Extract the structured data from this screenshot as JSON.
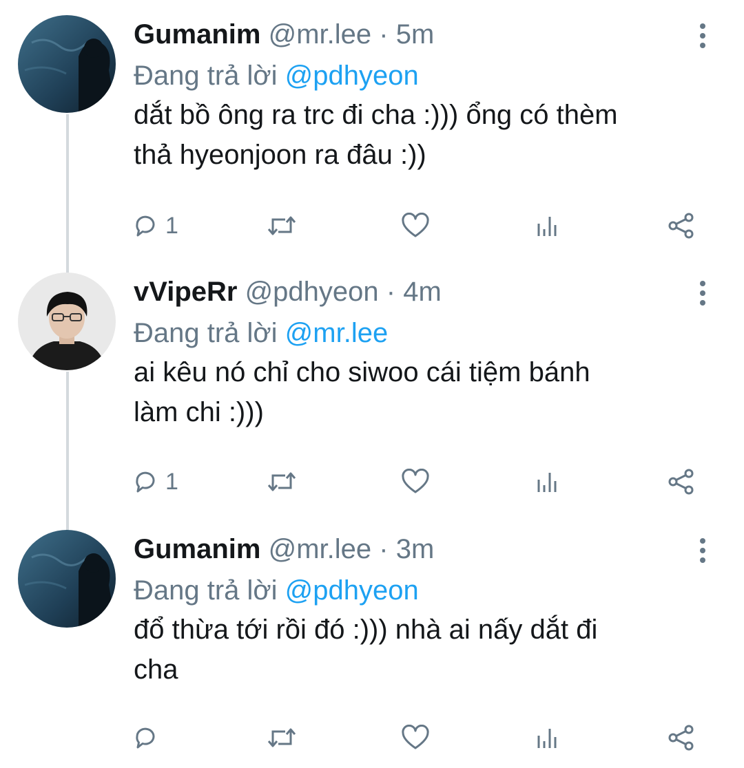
{
  "replying_prefix": "Đang trả lời",
  "tweets": [
    {
      "name": "Gumanim",
      "handle": "@mr.lee",
      "separator": "·",
      "time": "5m",
      "replying_to": "@pdhyeon",
      "text_line1": "dắt bồ ông ra trc đi cha :))) ổng có thèm",
      "text_line2": "thả hyeonjoon ra đâu :))",
      "reply_count": "1"
    },
    {
      "name": "vVipeRr",
      "handle": "@pdhyeon",
      "separator": "·",
      "time": "4m",
      "replying_to": "@mr.lee",
      "text_line1": "ai kêu nó chỉ cho siwoo cái tiệm bánh",
      "text_line2": "làm chi :)))",
      "reply_count": "1"
    },
    {
      "name": "Gumanim",
      "handle": "@mr.lee",
      "separator": "·",
      "time": "3m",
      "replying_to": "@pdhyeon",
      "text_line1": "đổ thừa tới rồi đó :))) nhà ai nấy dắt đi",
      "text_line2": "cha",
      "reply_count": ""
    }
  ],
  "colors": {
    "text": "#14171a",
    "secondary": "#657786",
    "accent": "#1da1f2",
    "thread_line": "#d4d9dd"
  },
  "icons": [
    "more-vertical-icon",
    "reply-icon",
    "retweet-icon",
    "like-icon",
    "analytics-icon",
    "share-icon"
  ]
}
